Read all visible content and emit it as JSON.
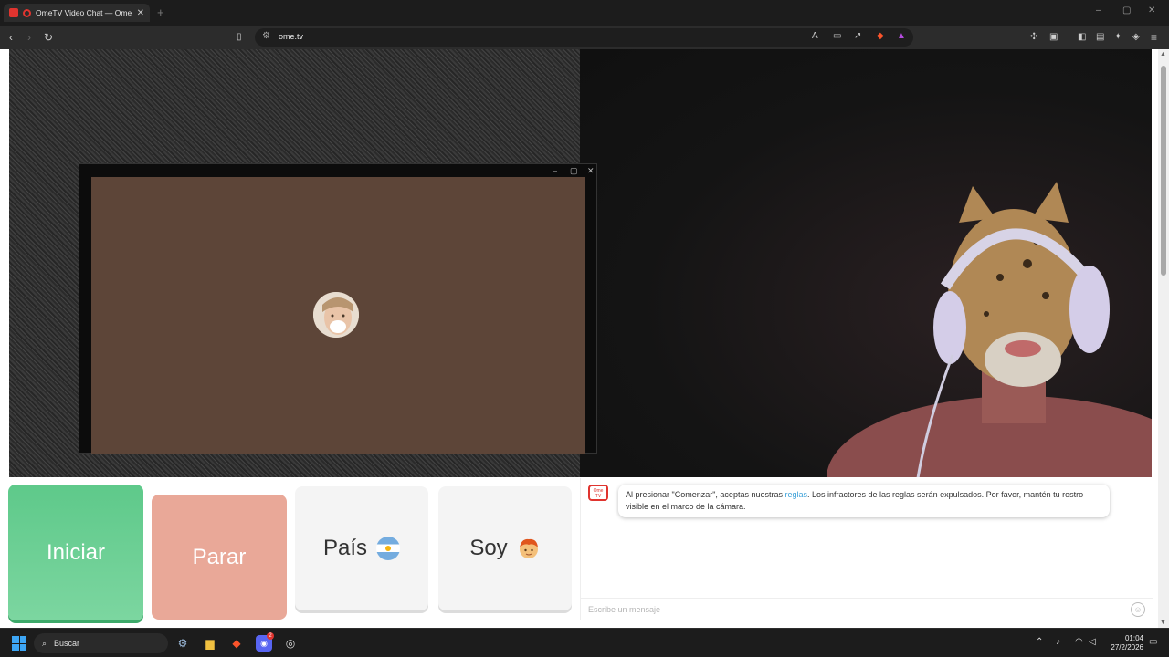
{
  "browser": {
    "tab_title": "OmeTV Video Chat — Omeg",
    "tab_close": "✕",
    "new_tab": "+",
    "url": "ome.tv",
    "window_controls": [
      "–",
      "▢",
      "✕"
    ]
  },
  "popup": {
    "controls": [
      "–",
      "▢",
      "✕"
    ]
  },
  "buttons": {
    "start": "Iniciar",
    "stop": "Parar",
    "country": "País",
    "soy": "Soy"
  },
  "chat": {
    "logo_top": "Ome",
    "logo_bottom": "TV",
    "message_pre": "Al presionar \"Comenzar\", aceptas nuestras ",
    "message_link": "reglas",
    "message_post": ". Los infractores de las reglas serán expulsados. Por favor, mantén tu rostro visible en el marco de la cámara.",
    "placeholder": "Escribe un mensaje",
    "emoji_icon": "☺"
  },
  "taskbar": {
    "search_label": "Buscar",
    "time": "01:04",
    "date": "27/2/2026",
    "discord_badge": "2"
  },
  "colors": {
    "start_button": "#5ec98a",
    "stop_button": "#e9a898",
    "brand_red": "#e0342f"
  }
}
